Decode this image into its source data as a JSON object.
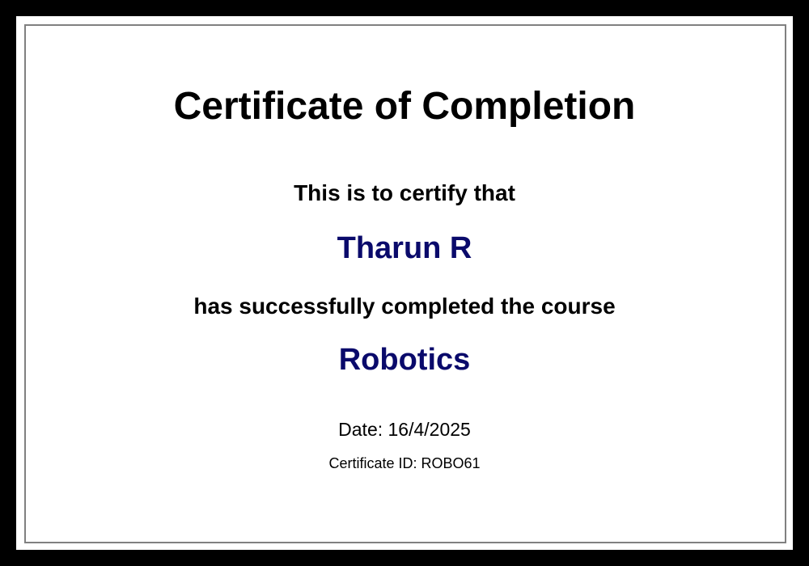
{
  "certificate": {
    "title": "Certificate of Completion",
    "certify_text": "This is to certify that",
    "recipient_name": "Tharun R",
    "completion_text": "has successfully completed the course",
    "course_name": "Robotics",
    "date_line": "Date: 16/4/2025",
    "certificate_id_line": "Certificate ID: ROBO61",
    "colors": {
      "background": "#ffffff",
      "frame": "#000000",
      "inner_border": "#808080",
      "highlight_text": "#0a0a6b"
    }
  }
}
